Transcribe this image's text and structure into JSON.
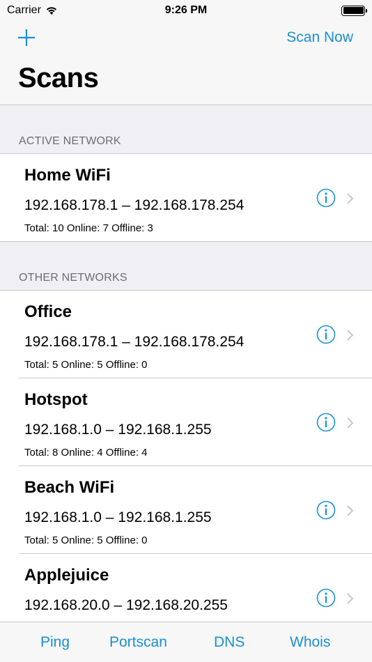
{
  "status_bar": {
    "carrier": "Carrier",
    "time": "9:26 PM"
  },
  "nav": {
    "add_icon": "plus-icon",
    "scan_now": "Scan Now",
    "title": "Scans"
  },
  "colors": {
    "accent": "#1a8fd6",
    "background": "#efeff4",
    "separator": "#c8c7cc"
  },
  "sections": {
    "active": {
      "header": "ACTIVE NETWORK",
      "items": [
        {
          "name": "Home WiFi",
          "range": "192.168.178.1 – 192.168.178.254",
          "stats": "Total: 10 Online: 7 Offline: 3"
        }
      ]
    },
    "other": {
      "header": "OTHER NETWORKS",
      "items": [
        {
          "name": "Office",
          "range": "192.168.178.1 – 192.168.178.254",
          "stats": "Total: 5 Online: 5 Offline: 0"
        },
        {
          "name": "Hotspot",
          "range": "192.168.1.0 – 192.168.1.255",
          "stats": "Total: 8 Online: 4 Offline: 4"
        },
        {
          "name": "Beach WiFi",
          "range": "192.168.1.0 – 192.168.1.255",
          "stats": "Total: 5 Online: 5 Offline: 0"
        },
        {
          "name": "Applejuice",
          "range": "192.168.20.0 – 192.168.20.255",
          "stats": ""
        }
      ]
    }
  },
  "tabs": [
    {
      "label": "Ping"
    },
    {
      "label": "Portscan"
    },
    {
      "label": "DNS"
    },
    {
      "label": "Whois"
    }
  ]
}
